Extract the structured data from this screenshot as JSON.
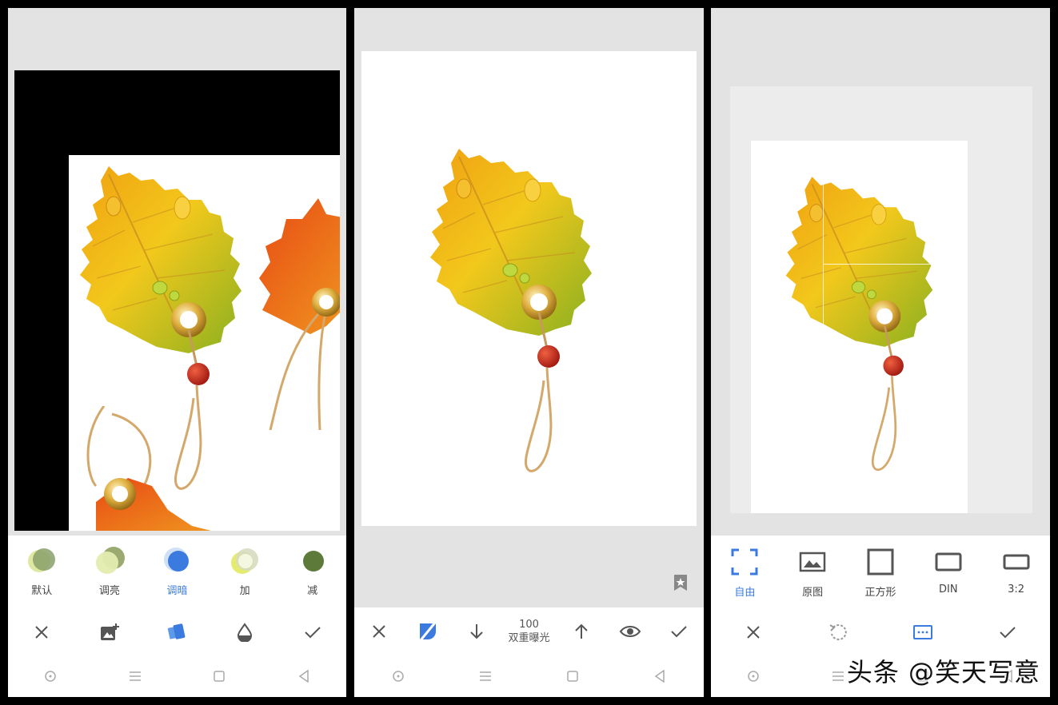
{
  "panel1": {
    "presets": [
      {
        "label": "默认",
        "color_a": "#c9d98a",
        "color_b": "#8aa06a"
      },
      {
        "label": "调亮",
        "color_a": "#e4ecb0",
        "color_b": "#9aaa70"
      },
      {
        "label": "调暗",
        "color_a": "#cfe0f7",
        "color_b": "#3b7be0"
      },
      {
        "label": "加",
        "color_a": "#eef4c8",
        "color_b": "#b9c48a"
      },
      {
        "label": "减",
        "color_a": "#5e7a3a",
        "color_b": "#5e7a3a"
      }
    ],
    "active_preset": "调暗",
    "toolbar_icons": [
      "close-icon",
      "add-image-icon",
      "style-palette-icon",
      "opacity-drop-icon",
      "check-icon"
    ]
  },
  "panel2": {
    "value": "100",
    "mode_label": "双重曝光",
    "toolbar_icons": [
      "close-icon",
      "mask-brush-icon",
      "arrow-down-icon",
      "arrow-up-icon",
      "eye-icon",
      "check-icon"
    ]
  },
  "panel3": {
    "crop_options": [
      {
        "label": "自由",
        "icon": "free-crop-icon"
      },
      {
        "label": "原图",
        "icon": "original-image-icon"
      },
      {
        "label": "正方形",
        "icon": "square-icon"
      },
      {
        "label": "DIN",
        "icon": "din-rect-icon"
      },
      {
        "label": "3:2",
        "icon": "ratio-rect-icon"
      }
    ],
    "active_option": "自由",
    "toolbar_icons": [
      "close-icon",
      "rotate-icon",
      "aspect-icon",
      "check-icon"
    ]
  },
  "navbar_icons": [
    "circle-nav-icon",
    "menu-nav-icon",
    "square-nav-icon",
    "back-nav-icon"
  ],
  "watermark": "头条 @笑天写意",
  "colors": {
    "accent": "#3b7be0",
    "leaf_yellow": "#e8b818",
    "leaf_green": "#9bb824",
    "leaf_orange": "#e0601a",
    "bead_red": "#c0281a",
    "cord": "#d4a86a"
  }
}
